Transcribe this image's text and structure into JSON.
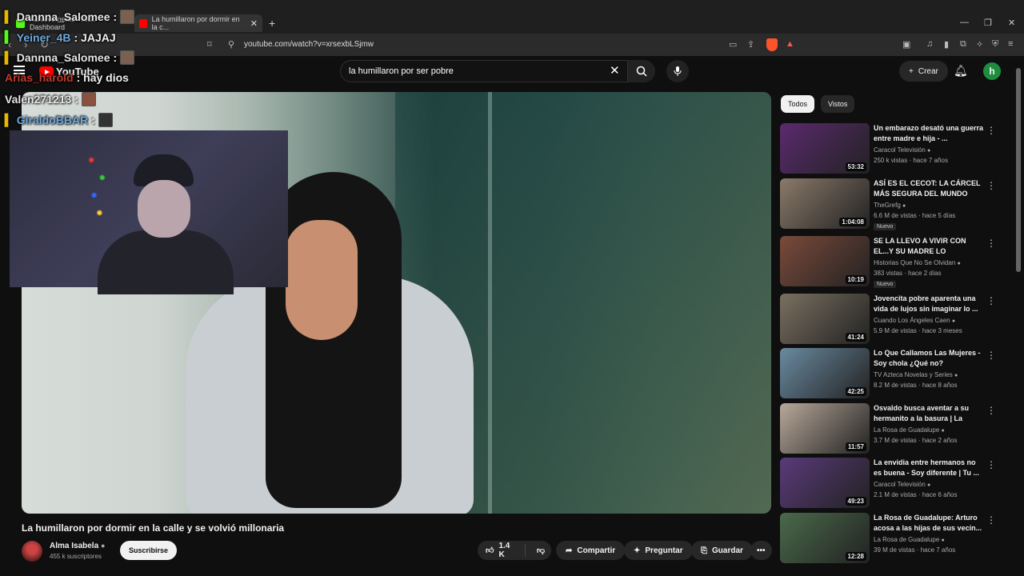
{
  "browser": {
    "tabs": [
      {
        "title": "Achievements - Kick Dashboard"
      },
      {
        "title": "La humillaron por dormir en la c..."
      }
    ],
    "url": "youtube.com/watch?v=xrsexbLSjmw"
  },
  "youtube": {
    "logo": "YouTube",
    "search_query": "la humillaron por ser pobre",
    "create_label": "Crear",
    "avatar_letter": "h"
  },
  "chat": [
    {
      "user": "Dannna_Salomee",
      "text": " :",
      "color": "#e8e8e8"
    },
    {
      "user": "Yeiner_4B",
      "text": " : JAJAJ",
      "color": "#6fa8dc"
    },
    {
      "user": "Dannna_Salomee",
      "text": " :",
      "color": "#e8e8e8"
    },
    {
      "user": "Arias_harold",
      "text": " : hay dios",
      "color": "#c0392b"
    },
    {
      "user": "Valen271213",
      "text": " :",
      "color": "#e8e8e8"
    },
    {
      "user": "GiraldoBBAR",
      "text": " :",
      "color": "#6fa8dc"
    }
  ],
  "video": {
    "title": "La humillaron por dormir en la calle y se volvió millonaria",
    "channel": "Alma Isabela",
    "subscribers": "455 k suscriptores",
    "subscribe_label": "Suscribirse",
    "likes": "1.4 K",
    "share_label": "Compartir",
    "ask_label": "Preguntar",
    "save_label": "Guardar"
  },
  "sidebar": {
    "chips": [
      "Todos",
      "Vistos"
    ],
    "recommendations": [
      {
        "title": "Un embarazo desató una guerra entre madre e hija - ...",
        "channel": "Caracol Televisión",
        "meta": "250 k vistas · hace 7 años",
        "duration": "53:32",
        "badge": "",
        "color": "#5b2a6e"
      },
      {
        "title": "ASÍ ES EL CECOT: LA CÁRCEL MÁS SEGURA DEL MUNDO",
        "channel": "TheGrefg",
        "meta": "6.6 M de vistas · hace 5 días",
        "duration": "1:04:08",
        "badge": "Nuevo",
        "color": "#8a7a6a"
      },
      {
        "title": "SE LA LLEVO A VIVIR CON EL...Y SU MADRE LO ARRUINO...",
        "channel": "Historias Que No Se Olvidan",
        "meta": "383 vistas · hace 2 días",
        "duration": "10:19",
        "badge": "Nuevo",
        "color": "#7a4a3a"
      },
      {
        "title": "Jovencita pobre aparenta una vida de lujos sin imaginar lo ...",
        "channel": "Cuando Los Ángeles Caen",
        "meta": "5.9 M de vistas · hace 3 meses",
        "duration": "41:24",
        "badge": "",
        "color": "#7a7060"
      },
      {
        "title": "Lo Que Callamos Las Mujeres - Soy chola ¿Qué no?",
        "channel": "TV Azteca Novelas y Series",
        "meta": "8.2 M de vistas · hace 8 años",
        "duration": "42:25",
        "badge": "",
        "color": "#6a8aa0"
      },
      {
        "title": "Osvaldo busca aventar a su hermanito a la basura | La rosa...",
        "channel": "La Rosa de Guadalupe",
        "meta": "3.7 M de vistas · hace 2 años",
        "duration": "11:57",
        "badge": "",
        "color": "#b8a89a"
      },
      {
        "title": "La envidia entre hermanos no es buena - Soy diferente | Tu ...",
        "channel": "Caracol Televisión",
        "meta": "2.1 M de vistas · hace 6 años",
        "duration": "49:23",
        "badge": "",
        "color": "#5a3a7a"
      },
      {
        "title": "La Rosa de Guadalupe: Arturo acosa a las hijas de sus vecin...",
        "channel": "La Rosa de Guadalupe",
        "meta": "39 M de vistas · hace 7 años",
        "duration": "12:28",
        "badge": "",
        "color": "#4a6a4a"
      }
    ]
  }
}
